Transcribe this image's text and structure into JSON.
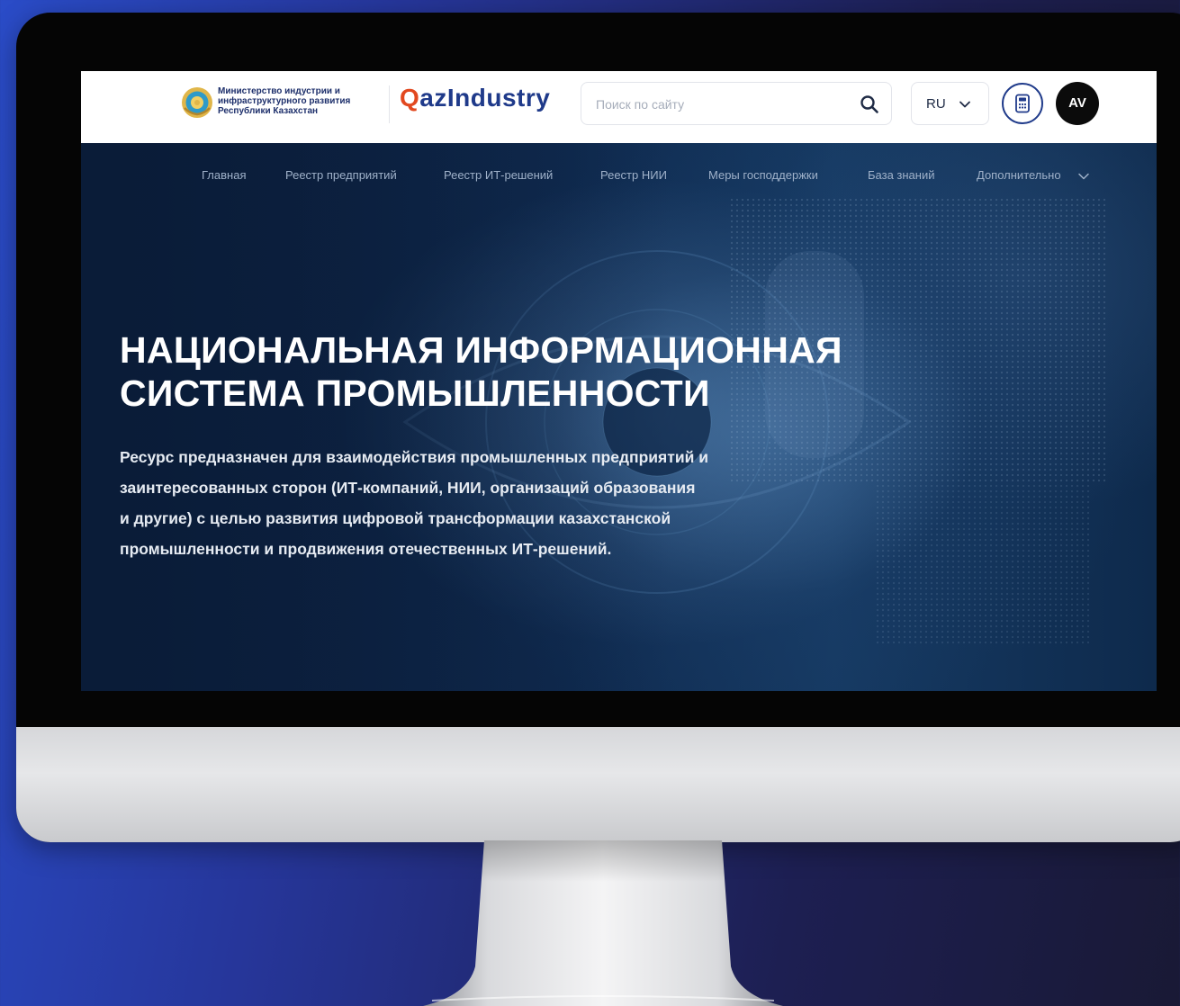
{
  "header": {
    "ministry_lines": [
      "Министерство индустрии и",
      "инфраструктурного развития",
      "Республики Казахстан"
    ],
    "brand": {
      "first_letter": "Q",
      "rest": "azIndustry"
    },
    "search": {
      "placeholder": "Поиск по сайту"
    },
    "language": {
      "selected": "RU"
    },
    "avatar_initials": "AV"
  },
  "nav": {
    "items": [
      "Главная",
      "Реестр предприятий",
      "Реестр ИТ-решений",
      "Реестр НИИ",
      "Меры господдержки",
      "База знаний",
      "Дополнительно"
    ]
  },
  "hero": {
    "title_lines": [
      "НАЦИОНАЛЬНАЯ ИНФОРМАЦИОННАЯ",
      "СИСТЕМА ПРОМЫШЛЕННОСТИ"
    ],
    "description_lines": [
      "Ресурс предназначен для взаимодействия промышленных предприятий и",
      "заинтересованных сторон (ИТ-компаний, НИИ, организаций образования",
      "и другие) с целью развития цифровой трансформации казахстанской",
      "промышленности и продвижения отечественных ИТ-решений."
    ]
  },
  "colors": {
    "background_left": "#2a4cc8",
    "background_right": "#191935",
    "brand_accent": "#e2481f",
    "brand_primary": "#1f3a8a",
    "hero_bg": "#0b2140",
    "nav_text": "#9fb1c9"
  },
  "icons": [
    "emblem-icon",
    "search-icon",
    "chevron-down-icon",
    "calculator-icon",
    "avatar"
  ]
}
